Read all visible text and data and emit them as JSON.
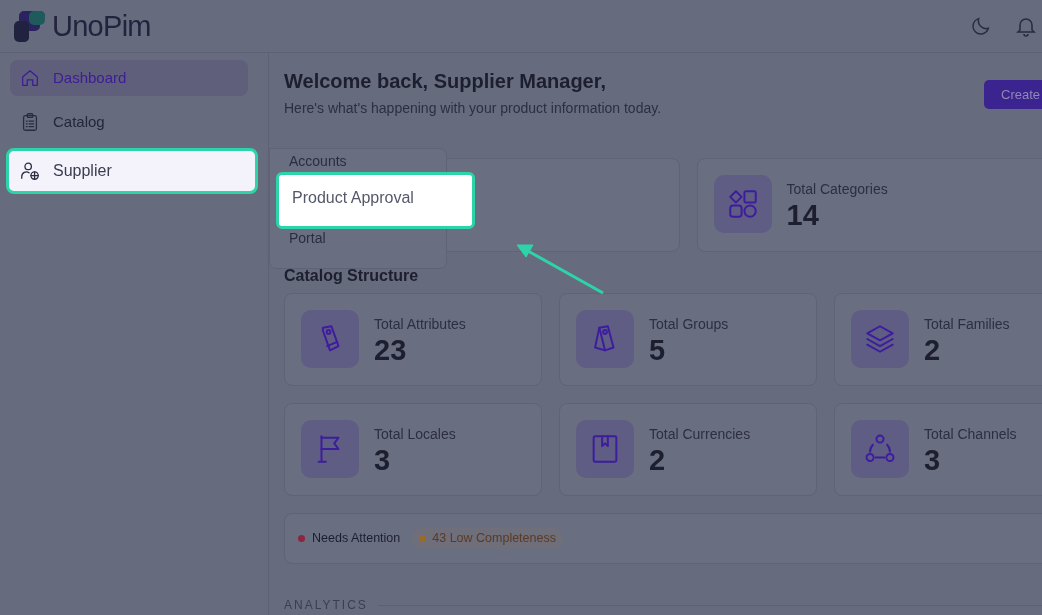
{
  "header": {
    "logo_text": "UnoPim"
  },
  "sidebar": {
    "items": [
      {
        "label": "Dashboard",
        "kind": "home",
        "selected": true,
        "highlighted": false
      },
      {
        "label": "Catalog",
        "kind": "clipboard",
        "selected": false,
        "highlighted": false
      },
      {
        "label": "Supplier",
        "kind": "user-box",
        "selected": false,
        "highlighted": true
      }
    ]
  },
  "submenu": {
    "items": [
      {
        "label": "Accounts",
        "highlighted": false
      },
      {
        "label": "Product Approval",
        "highlighted": true
      },
      {
        "label": "Portal",
        "highlighted": false
      }
    ]
  },
  "page": {
    "title": "Welcome back, Supplier Manager,",
    "subtitle": "Here's what's happening with your product information today.",
    "primary_button": "Create",
    "overview_cards": [
      {
        "kind": "shapes",
        "label": "Total Categories",
        "value": "14"
      }
    ],
    "structure_heading": "Catalog Structure",
    "structure_cards": [
      {
        "kind": "tag",
        "label": "Total Attributes",
        "value": "23"
      },
      {
        "kind": "tags",
        "label": "Total Groups",
        "value": "5"
      },
      {
        "kind": "layers",
        "label": "Total Families",
        "value": "2"
      },
      {
        "kind": "flag",
        "label": "Total Locales",
        "value": "3"
      },
      {
        "kind": "bookmark",
        "label": "Total Currencies",
        "value": "2"
      },
      {
        "kind": "nodes",
        "label": "Total Channels",
        "value": "3"
      }
    ],
    "alerts": [
      {
        "kind": "plain",
        "label": "Needs Attention",
        "color": "#8d2540"
      },
      {
        "kind": "pill",
        "label": "43 Low Completeness",
        "color": "#9a6a2a"
      }
    ],
    "section_label": "ANALYTICS"
  }
}
